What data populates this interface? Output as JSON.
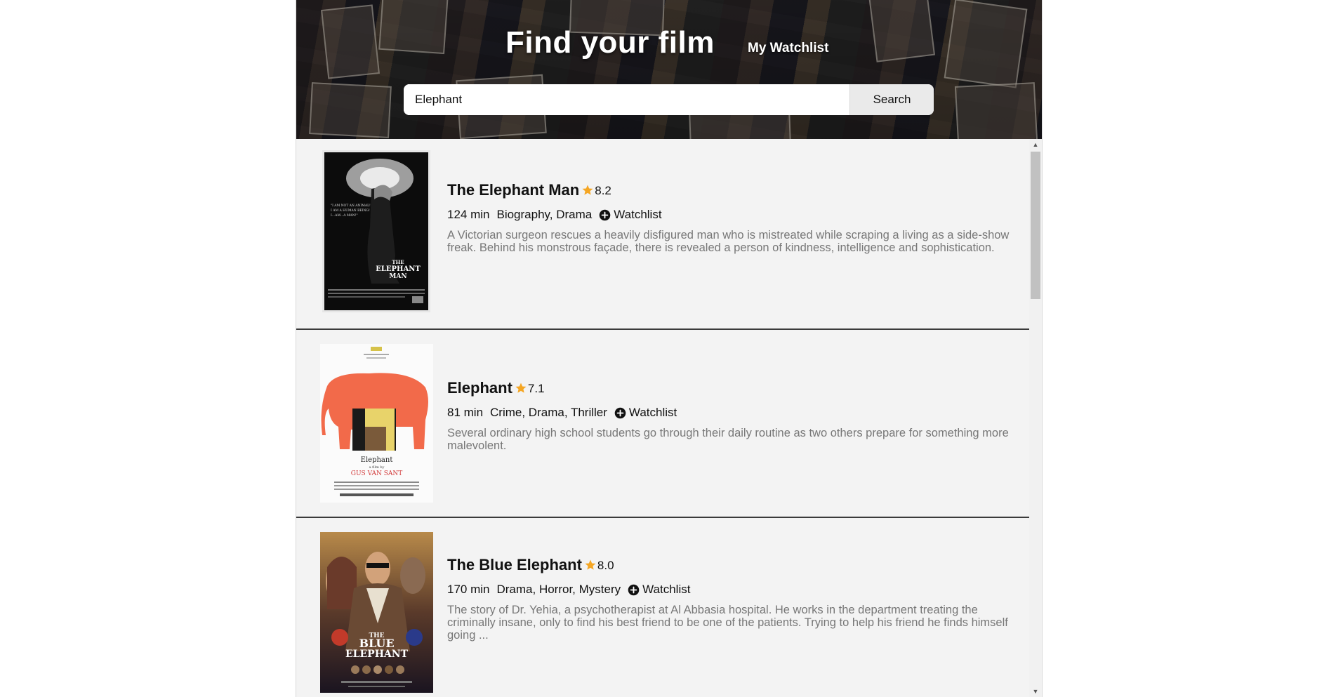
{
  "header": {
    "title": "Find your film",
    "watchlist_link": "My Watchlist"
  },
  "search": {
    "value": "Elephant",
    "placeholder": "",
    "button_label": "Search"
  },
  "films": [
    {
      "title": "The Elephant Man",
      "rating": "8.2",
      "runtime": "124 min",
      "genres": "Biography, Drama",
      "watchlist_label": "Watchlist",
      "description": "A Victorian surgeon rescues a heavily disfigured man who is mistreated while scraping a living as a side-show freak. Behind his monstrous façade, there is revealed a person of kindness, intelligence and sophistication.",
      "poster": {
        "title_text": "THE ELEPHANT MAN",
        "quote": "\"I AM NOT AN ANIMAL! I AM A HUMAN BEING! I...AM...A MAN!\""
      }
    },
    {
      "title": "Elephant",
      "rating": "7.1",
      "runtime": "81 min",
      "genres": "Crime, Drama, Thriller",
      "watchlist_label": "Watchlist",
      "description": "Several ordinary high school students go through their daily routine as two others prepare for something more malevolent.",
      "poster": {
        "title_text": "Elephant",
        "subtitle": "a film by",
        "director": "GUS VAN SANT"
      }
    },
    {
      "title": "The Blue Elephant",
      "rating": "8.0",
      "runtime": "170 min",
      "genres": "Drama, Horror, Mystery",
      "watchlist_label": "Watchlist",
      "description": "The story of Dr. Yehia, a psychotherapist at Al Abbasia hospital. He works in the department treating the criminally insane, only to find his best friend to be one of the patients. Trying to help his friend he finds himself going ...",
      "poster": {
        "title_text": "THE BLUE ELEPHANT"
      }
    }
  ],
  "icons": {
    "star": "star-icon",
    "plus": "plus-circle-icon"
  },
  "colors": {
    "star": "#f5a623",
    "divider": "#3a3a3a",
    "description": "#777777"
  }
}
